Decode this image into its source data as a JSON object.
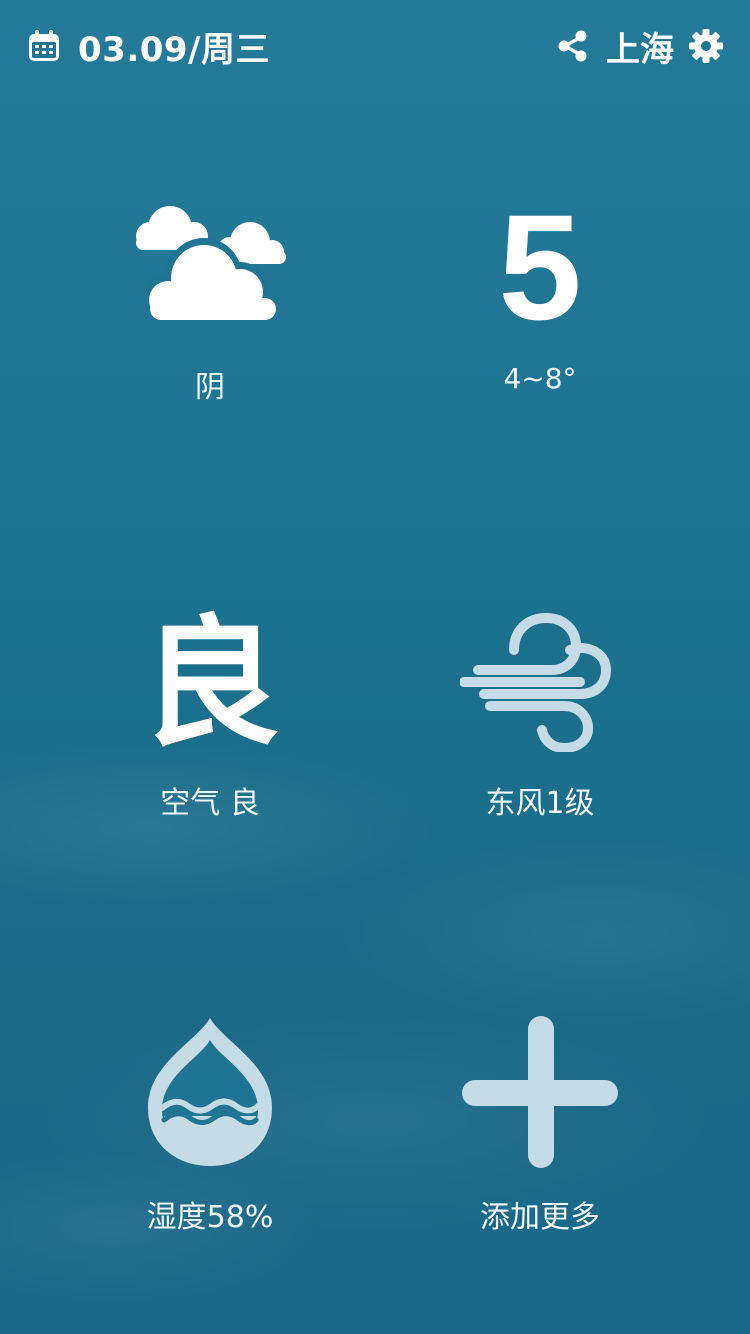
{
  "header": {
    "date": "03.09/周三",
    "city": "上海",
    "calendar_icon": "calendar-icon",
    "share_icon": "share-icon",
    "settings_icon": "gear-icon"
  },
  "tiles": {
    "weather": {
      "icon": "cloudy-icon",
      "label": "阴"
    },
    "temperature": {
      "value": "5",
      "range": "4~8°"
    },
    "air": {
      "value": "良",
      "label": "空气 良"
    },
    "wind": {
      "icon": "wind-icon",
      "label": "东风1级"
    },
    "humidity": {
      "icon": "humidity-drop-icon",
      "label": "湿度58%"
    },
    "add_more": {
      "icon": "plus-icon",
      "label": "添加更多"
    }
  },
  "colors": {
    "background": "#1f7593",
    "foreground": "#ffffff",
    "icon_muted": "#c5dbe5"
  }
}
